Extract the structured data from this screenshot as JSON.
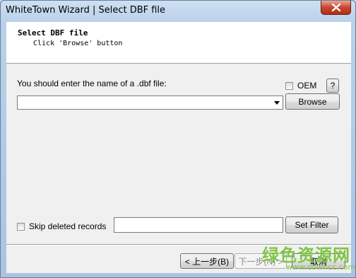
{
  "window": {
    "title": "WhiteTown Wizard | Select DBF file"
  },
  "header": {
    "title": "Select DBF file",
    "subtitle": "Click 'Browse' button"
  },
  "main": {
    "dbf_label": "You should enter the name of a .dbf file:",
    "oem_label": "OEM",
    "oem_checked": false,
    "help_label": "?",
    "file_value": "",
    "browse_label": "Browse",
    "skip_label": "Skip deleted records",
    "skip_checked": false,
    "filter_value": "",
    "set_filter_label": "Set Filter"
  },
  "footer": {
    "back_label": "< 上一步(B)",
    "next_label": "下一步(N) >",
    "cancel_label": "取消"
  },
  "watermark": {
    "main": "绿色资源网",
    "sub": "www.downcc.com"
  },
  "icons": {
    "close": "close-icon",
    "dropdown": "chevron-down-icon"
  },
  "colors": {
    "close_button": "#c7452f",
    "title_bar": "#b9d1ea",
    "watermark": "#7ec543"
  }
}
